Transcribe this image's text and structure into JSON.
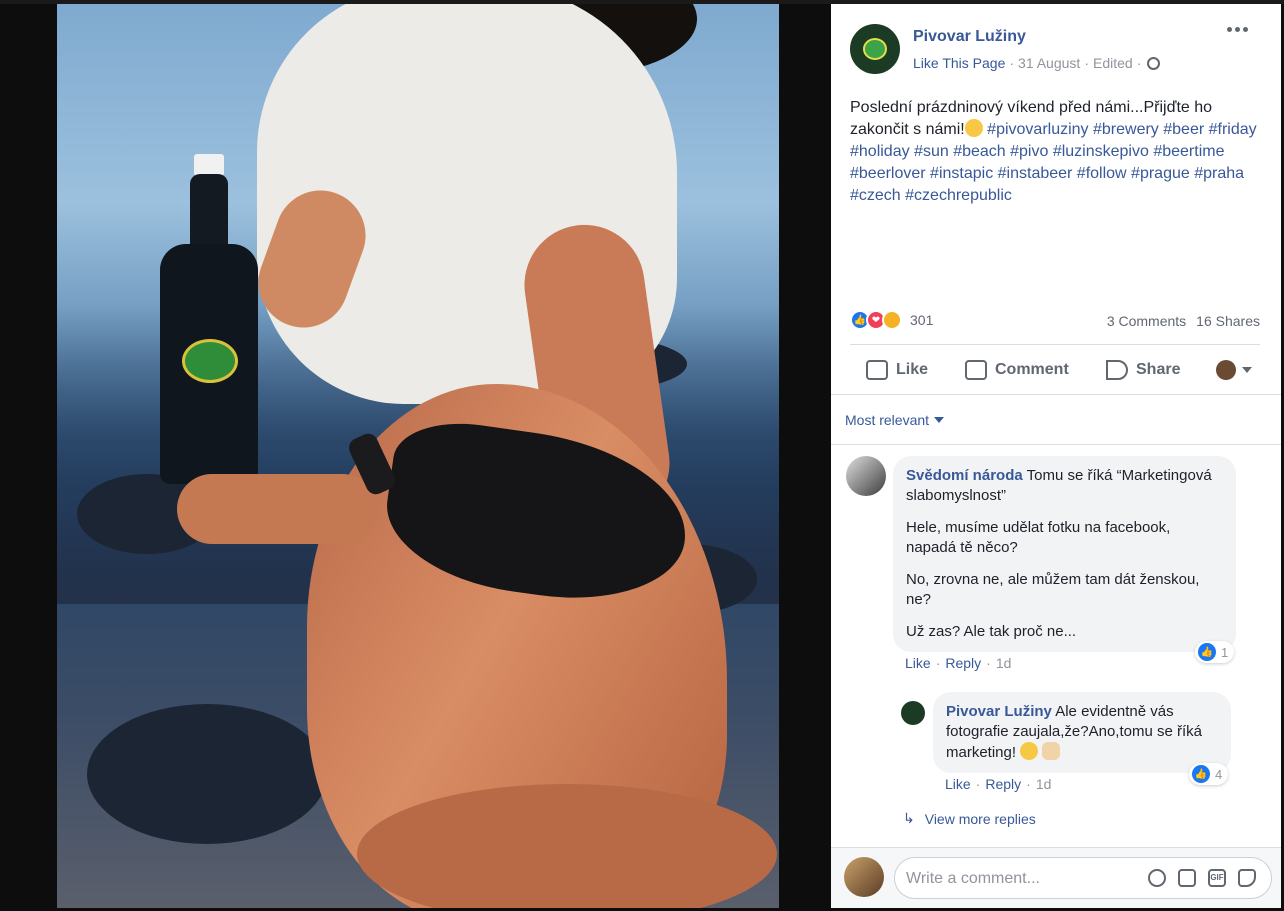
{
  "post": {
    "page_name": "Pivovar Lužiny",
    "like_page": "Like This Page",
    "date": "31 August",
    "edited": "Edited",
    "sep": "·",
    "text_line1": "Poslední prázdninový víkend před námi...Přijďte ho zakončit s námi!",
    "hashtags": "#pivovarluziny #brewery #beer #friday #holiday #sun #beach #pivo #luzinskepivo #beertime #beerlover #instapic #instabeer #follow #prague #praha #czech #czechrepublic",
    "reaction_count": "301",
    "comments": "3 Comments",
    "shares": "16 Shares"
  },
  "actions": {
    "like": "Like",
    "comment": "Comment",
    "share": "Share"
  },
  "sort": "Most relevant",
  "comments": [
    {
      "author": "Svědomí národa",
      "lead": "Tomu se říká “Marketingová slabomyslnost”",
      "paragraphs": [
        "Hele, musíme udělat fotku na facebook, napadá tě něco?",
        "No, zrovna ne, ale můžem tam dát ženskou, ne?",
        "Už zas? Ale tak proč ne..."
      ],
      "like": "Like",
      "reply": "Reply",
      "time": "1d",
      "reactions": "1"
    },
    {
      "author": "Pivovar Lužiny",
      "text": "Ale evidentně vás fotografie zaujala,že?Ano,tomu se říká marketing!",
      "like": "Like",
      "reply": "Reply",
      "time": "1d",
      "reactions": "4"
    }
  ],
  "view_more": "View more replies",
  "composer": {
    "placeholder": "Write a comment...",
    "gif": "GIF"
  },
  "colors": {
    "link": "#385898",
    "like_blue": "#1877f2",
    "love_red": "#f33e58",
    "wow_yellow": "#f7b125"
  }
}
